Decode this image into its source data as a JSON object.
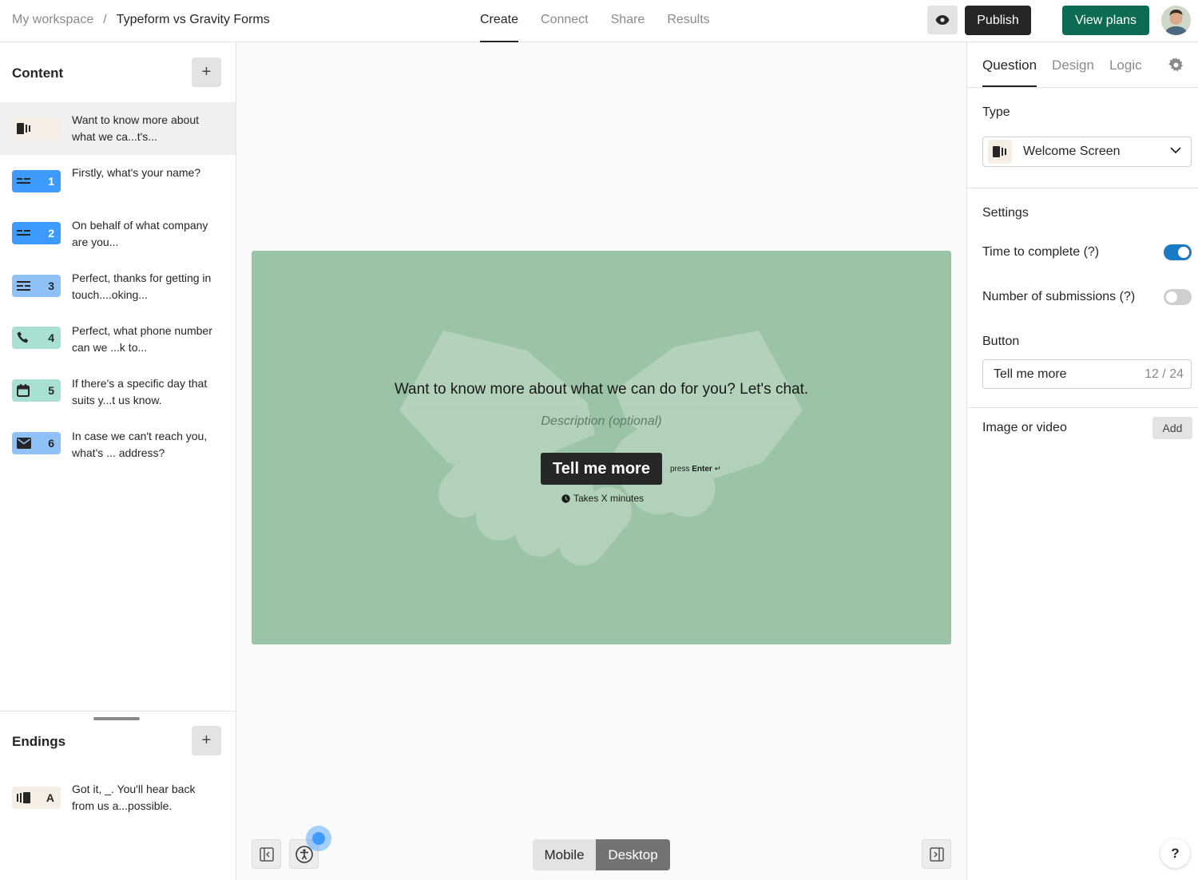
{
  "breadcrumb": {
    "workspace": "My workspace",
    "separator": "/",
    "form": "Typeform vs Gravity Forms"
  },
  "tabs": [
    {
      "label": "Create",
      "active": true
    },
    {
      "label": "Connect",
      "active": false
    },
    {
      "label": "Share",
      "active": false
    },
    {
      "label": "Results",
      "active": false
    }
  ],
  "toolbar": {
    "preview_icon": "eye-icon",
    "publish_label": "Publish",
    "view_plans_label": "View plans"
  },
  "content_panel": {
    "title": "Content",
    "items": [
      {
        "badge": "",
        "icon": "welcome-screen-icon",
        "text": "Want to know more about what we ca...t's...",
        "color": "#f6ede4"
      },
      {
        "badge": "1",
        "icon": "short-text-icon",
        "text": "Firstly, what's your name?",
        "color": "#3d9bff"
      },
      {
        "badge": "2",
        "icon": "short-text-icon",
        "text": "On behalf of what company are you...",
        "color": "#3d9bff"
      },
      {
        "badge": "3",
        "icon": "long-text-icon",
        "text": "Perfect, thanks for getting in touch....oking...",
        "color": "#8fc1f7"
      },
      {
        "badge": "4",
        "icon": "phone-icon",
        "text": "Perfect, what phone number can we ...k to...",
        "color": "#a8e0d3"
      },
      {
        "badge": "5",
        "icon": "calendar-icon",
        "text": "If there's a specific day that suits y...t us know.",
        "color": "#a8e0d3"
      },
      {
        "badge": "6",
        "icon": "email-icon",
        "text": "In case we can't reach you, what's ... address?",
        "color": "#8fc1f7"
      }
    ]
  },
  "endings_panel": {
    "title": "Endings",
    "items": [
      {
        "badge": "A",
        "icon": "ending-screen-icon",
        "text": "Got it, _. You'll hear back from us a...possible."
      }
    ]
  },
  "preview": {
    "title": "Want to know more about what we can do for you? Let's chat.",
    "description_placeholder": "Description (optional)",
    "button_label": "Tell me more",
    "press_hint_prefix": "press",
    "press_hint_key": "Enter",
    "press_hint_symbol": "↵",
    "time_note": "Takes X minutes",
    "background_color": "#9bc3a6",
    "image_icon": "handshake-icon"
  },
  "device_toggle": {
    "mobile_label": "Mobile",
    "desktop_label": "Desktop",
    "selected": "Desktop"
  },
  "settings_panel": {
    "tabs": [
      {
        "label": "Question",
        "active": true
      },
      {
        "label": "Design",
        "active": false
      },
      {
        "label": "Logic",
        "active": false
      }
    ],
    "type_label": "Type",
    "type_value": "Welcome Screen",
    "settings_label": "Settings",
    "time_to_complete_label": "Time to complete (?)",
    "time_to_complete_on": true,
    "submissions_label": "Number of submissions (?)",
    "submissions_on": false,
    "button_section_label": "Button",
    "button_value": "Tell me more",
    "button_counter": "12 / 24",
    "image_label": "Image or video",
    "add_label": "Add"
  },
  "help": {
    "label": "?"
  },
  "colors": {
    "brand_dark": "#262627",
    "plans_green": "#0e6b53",
    "toggle_on": "#1b7ac6",
    "badge_blue": "#3d9bff"
  }
}
